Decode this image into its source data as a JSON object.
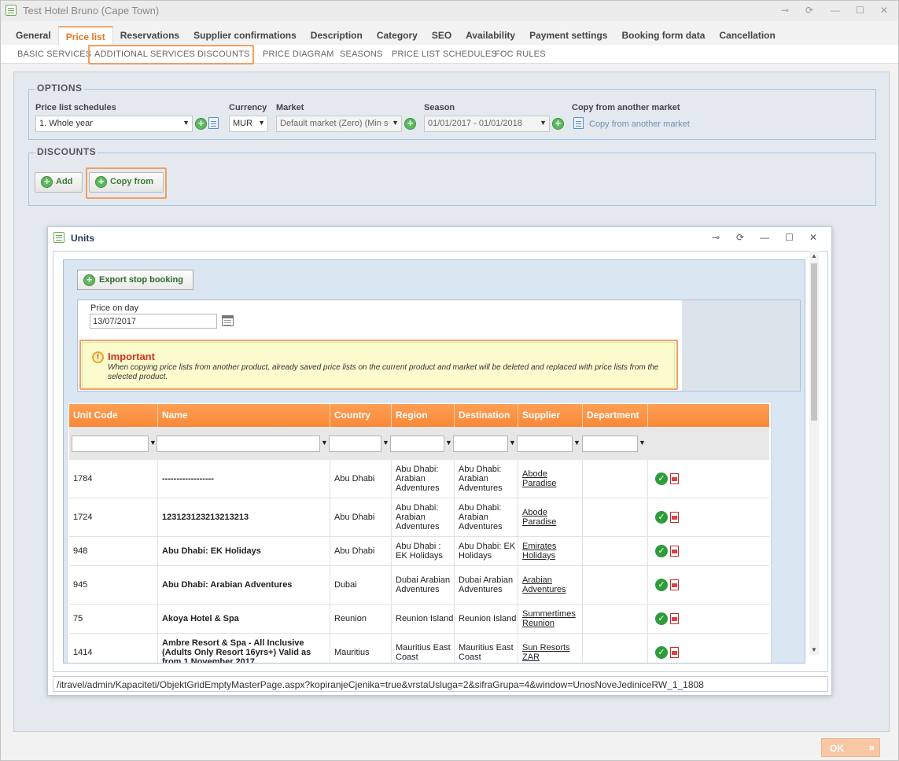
{
  "window": {
    "title": "Test Hotel Bruno (Cape Town)",
    "controls": {
      "pin": "⊸",
      "refresh": "⟳",
      "minimize": "—",
      "maximize": "☐",
      "close": "✕"
    }
  },
  "tabs": [
    {
      "label": "General",
      "active": false
    },
    {
      "label": "Price list",
      "active": true
    },
    {
      "label": "Reservations",
      "active": false
    },
    {
      "label": "Supplier confirmations",
      "active": false
    },
    {
      "label": "Description",
      "active": false
    },
    {
      "label": "Category",
      "active": false
    },
    {
      "label": "SEO",
      "active": false
    },
    {
      "label": "Availability",
      "active": false
    },
    {
      "label": "Payment settings",
      "active": false
    },
    {
      "label": "Booking form data",
      "active": false
    },
    {
      "label": "Cancellation",
      "active": false
    }
  ],
  "subtabs": [
    "BASIC SERVICES",
    "ADDITIONAL SERVICES",
    "DISCOUNTS",
    "PRICE DIAGRAM",
    "SEASONS",
    "PRICE LIST SCHEDULES",
    "FOC RULES"
  ],
  "options": {
    "legend": "OPTIONS",
    "price_list_schedules": {
      "label": "Price list schedules",
      "value": "1. Whole year"
    },
    "currency": {
      "label": "Currency",
      "value": "MUR"
    },
    "market": {
      "label": "Market",
      "value": "Default market (Zero) (Min s"
    },
    "season": {
      "label": "Season",
      "value": "01/01/2017 - 01/01/2018"
    },
    "copy_market": {
      "label": "Copy from another market",
      "link": "Copy from another market"
    }
  },
  "discounts": {
    "legend": "DISCOUNTS",
    "add_label": "Add",
    "copy_from_label": "Copy from"
  },
  "ok_button": {
    "label": "OK",
    "chevrons": "»"
  },
  "dialog": {
    "title": "Units",
    "controls": {
      "pin": "⊸",
      "refresh": "⟳",
      "minimize": "—",
      "maximize": "☐",
      "close": "✕"
    },
    "export_label": "Export stop booking",
    "price_on_day": {
      "label": "Price on day",
      "value": "13/07/2017"
    },
    "important": {
      "title": "Important",
      "text": "When copying price lists from another product, already saved price lists on the current product and market will be deleted and replaced with price lists from the selected product."
    },
    "status_url": "/itravel/admin/Kapaciteti/ObjektGridEmptyMasterPage.aspx?kopiranjeCjenika=true&vrstaUsluga=2&sifraGrupa=4&window=UnosNoveJediniceRW_1_1808",
    "columns": [
      "Unit Code",
      "Name",
      "Country",
      "Region",
      "Destination",
      "Supplier",
      "Department",
      ""
    ],
    "rows": [
      {
        "code": "1784",
        "name": "------------------",
        "country": "Abu Dhabi",
        "region": "Abu Dhabi: Arabian Adventures",
        "destination": "Abu Dhabi: Arabian Adventures",
        "supplier": "Abode Paradise",
        "department": ""
      },
      {
        "code": "1724",
        "name": "123123123213213213",
        "country": "Abu Dhabi",
        "region": "Abu Dhabi: Arabian Adventures",
        "destination": "Abu Dhabi: Arabian Adventures",
        "supplier": "Abode Paradise",
        "department": ""
      },
      {
        "code": "948",
        "name": "Abu Dhabi: EK Holidays",
        "country": "Abu Dhabi",
        "region": "Abu Dhabi : EK Holidays",
        "destination": "Abu Dhabi: EK Holidays",
        "supplier": "Emirates Holidays",
        "department": ""
      },
      {
        "code": "945",
        "name": "Abu Dhabi: Arabian Adventures",
        "country": "Dubai",
        "region": "Dubai Arabian Adventures",
        "destination": "Dubai Arabian Adventures",
        "supplier": "Arabian Adventures",
        "department": ""
      },
      {
        "code": "75",
        "name": "Akoya Hotel & Spa",
        "country": "Reunion",
        "region": "Reunion Island",
        "destination": "Reunion Island",
        "supplier": "Summertimes Reunion",
        "department": ""
      },
      {
        "code": "1414",
        "name": "Ambre Resort & Spa - All Inclusive (Adults Only Resort 16yrs+) Valid as from 1 November 2017",
        "country": "Mauritius",
        "region": "Mauritius East Coast",
        "destination": "Mauritius East Coast",
        "supplier": "Sun Resorts ZAR",
        "department": ""
      }
    ]
  },
  "colors": {
    "accent": "#f98838",
    "highlight": "#f0a060",
    "ok_green": "#2e9c3b",
    "important_title": "#d2321e"
  }
}
